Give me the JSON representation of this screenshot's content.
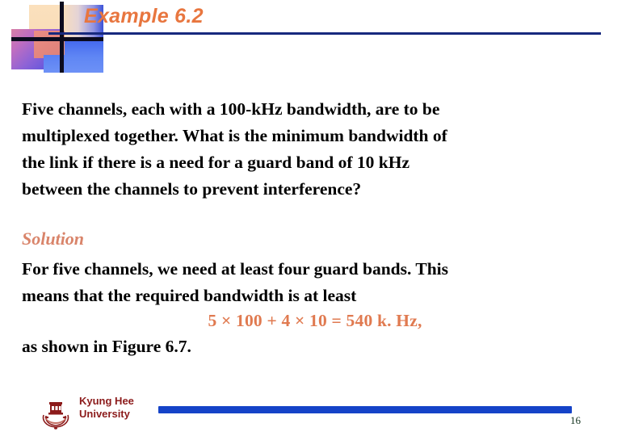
{
  "slide": {
    "title": "Example 6.2",
    "page_number": "16",
    "accent_orange": "#e8763f",
    "rule_navy": "#17297e",
    "footer_blue": "#1543c8",
    "university_red": "#8c1b1b"
  },
  "question": {
    "line1": "Five channels, each with a 100-kHz bandwidth, are to be",
    "line2": "multiplexed together. What is the minimum bandwidth of",
    "line3": "the link if there is a need for a guard band of 10 kHz",
    "line4": "between the channels to prevent interference?"
  },
  "solution": {
    "heading": "Solution",
    "line1": "For five channels, we need at least four guard bands. This",
    "line2": "means that the required bandwidth is at least",
    "formula": "5 × 100 + 4 × 10 = 540 k. Hz,",
    "closing": "as shown in Figure 6.7."
  },
  "footer": {
    "university_line1": "Kyung Hee",
    "university_line2": "University",
    "logo_name": "kyung-hee-university-crest"
  }
}
